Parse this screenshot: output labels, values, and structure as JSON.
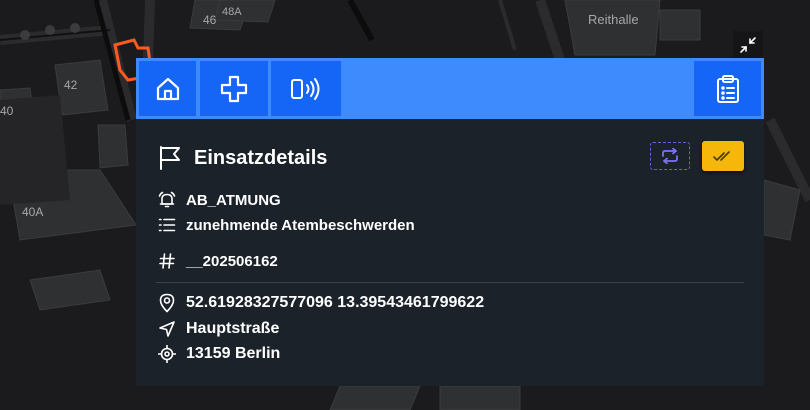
{
  "map": {
    "labels": [
      "46",
      "48A",
      "Reithalle",
      "42",
      "40",
      "40A"
    ]
  },
  "toolbar": {
    "home_icon": "home-icon",
    "add_icon": "plus-icon",
    "radio_icon": "radio-signal-icon",
    "clipboard_icon": "clipboard-list-icon"
  },
  "details": {
    "title": "Einsatzdetails",
    "keyword": "AB_ATMUNG",
    "description": "zunehmende Atembeschwerden",
    "number": "__202506162",
    "coordinates": "52.61928327577096 13.39543461799622",
    "street": "Hauptstraße",
    "city": "13159 Berlin"
  },
  "colors": {
    "toolbar_bg": "#3d8bfd",
    "button_bg": "#1565f6",
    "panel_bg": "#1c222a",
    "ack_button": "#f5b70a",
    "refresh_border": "#6b5fd8",
    "map_marker": "#ff5a1f"
  }
}
